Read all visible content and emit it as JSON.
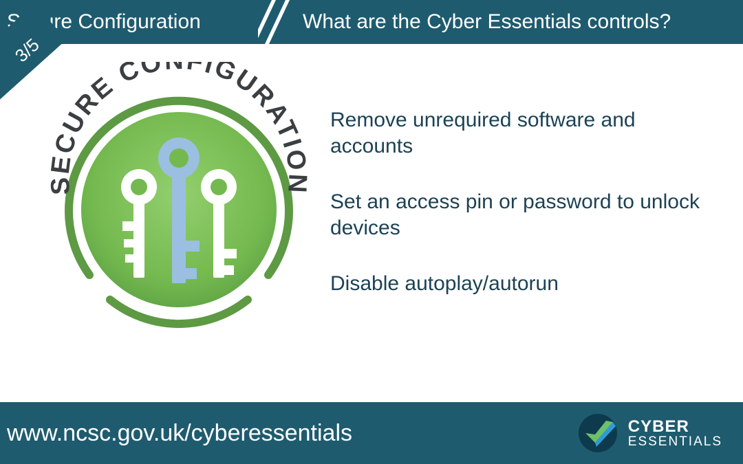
{
  "header": {
    "left_title": "Secure Configuration",
    "right_title": "What are the Cyber Essentials controls?"
  },
  "page_indicator": "3/5",
  "badge": {
    "curved_label": "SECURE CONFIGURATION"
  },
  "bullets": [
    "Remove unrequired software and accounts",
    "Set an access pin or password to unlock devices",
    "Disable autoplay/autorun"
  ],
  "footer": {
    "url": "www.ncsc.gov.uk/cyberessentials",
    "logo_line1": "CYBER",
    "logo_line2": "ESSENTIALS"
  },
  "colors": {
    "brand_teal": "#1f5b6e",
    "badge_green_outer": "#6bab4b",
    "badge_green_inner": "#7cbb56",
    "key_blue": "#9bbfe0",
    "text_dark": "#1c4254"
  }
}
